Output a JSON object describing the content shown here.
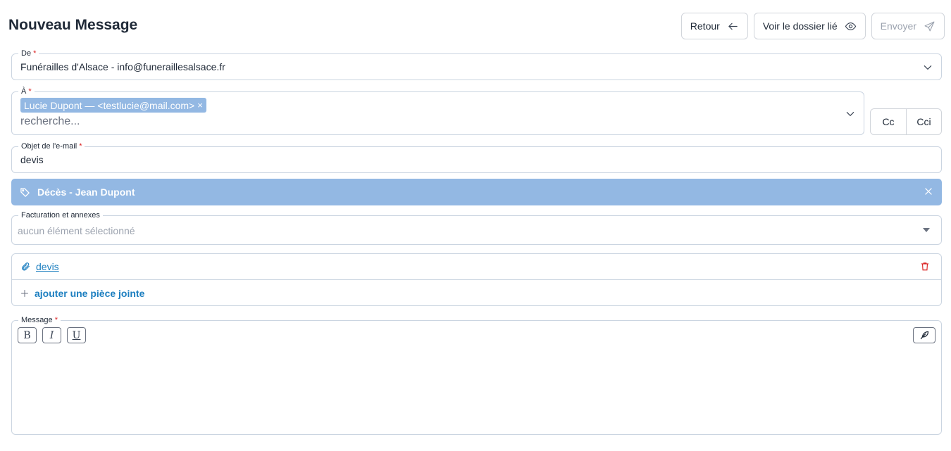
{
  "page": {
    "title": "Nouveau Message"
  },
  "actions": {
    "back": "Retour",
    "view_folder": "Voir le dossier lié",
    "send": "Envoyer"
  },
  "from": {
    "label": "De",
    "required": "*",
    "value": "Funérailles d'Alsace - info@funeraillesalsace.fr"
  },
  "to": {
    "label": "À",
    "required": "*",
    "chip": "Lucie Dupont — <testlucie@mail.com>",
    "chip_remove": "×",
    "placeholder": "recherche..."
  },
  "cc": {
    "cc": "Cc",
    "bcc": "Cci"
  },
  "subject": {
    "label": "Objet de l'e-mail",
    "required": "*",
    "value": "devis"
  },
  "folder_tag": {
    "label": "Décès - Jean Dupont",
    "color": "#93b8e3"
  },
  "billing": {
    "label": "Facturation et annexes",
    "placeholder": "aucun élément sélectionné"
  },
  "attachments": {
    "items": [
      {
        "name": "devis"
      }
    ],
    "add_label": "ajouter une pièce jointe"
  },
  "message": {
    "label": "Message",
    "required": "*",
    "bold": "B",
    "italic": "I",
    "underline": "U"
  }
}
